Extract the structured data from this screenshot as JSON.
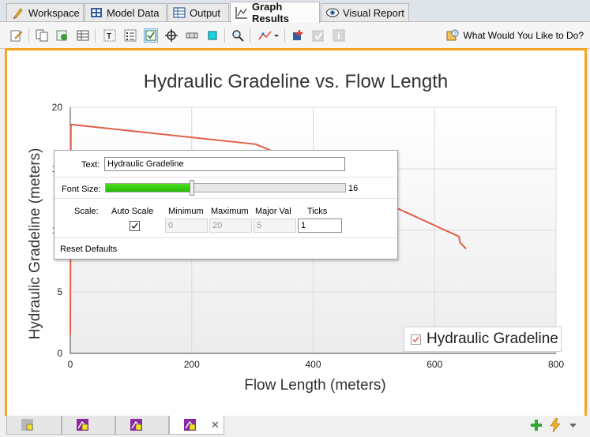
{
  "tabs": [
    {
      "label": "Workspace",
      "icon": "workspace-icon",
      "active": false
    },
    {
      "label": "Model Data",
      "icon": "model-data-icon",
      "active": false
    },
    {
      "label": "Output",
      "icon": "output-icon",
      "active": false
    },
    {
      "label": "Graph Results",
      "icon": "graph-results-icon",
      "active": true
    },
    {
      "label": "Visual Report",
      "icon": "visual-report-icon",
      "active": false
    }
  ],
  "toolbar": {
    "icons": [
      "edit-icon",
      "copy-icon",
      "export-icon",
      "table-icon",
      "format-text-icon",
      "list-icon",
      "checkbox-icon",
      "crosshair-icon",
      "segment-icon",
      "square-icon",
      "zoom-icon",
      "line-style-icon",
      "add-icon",
      "check-disabled-icon",
      "info-disabled-icon"
    ],
    "what_would_you_like": "What Would You Like to Do?"
  },
  "graph": {
    "title": "Hydraulic Gradeline vs. Flow Length",
    "xlabel": "Flow Length (meters)",
    "ylabel": "Hydraulic Gradeline (meters)",
    "legend_label": "Hydraulic Gradeline",
    "legend_checked": true
  },
  "chart_data": {
    "type": "line",
    "title": "Hydraulic Gradeline vs. Flow Length",
    "xlabel": "Flow Length (meters)",
    "ylabel": "Hydraulic Gradeline (meters)",
    "xlim": [
      0,
      800
    ],
    "ylim": [
      0,
      20
    ],
    "xticks": [
      0,
      200,
      400,
      600,
      800
    ],
    "yticks": [
      0,
      5,
      10,
      15,
      20
    ],
    "grid": true,
    "legend_position": "bottom-right",
    "series": [
      {
        "name": "Hydraulic Gradeline",
        "color": "#e0604a",
        "x": [
          0,
          1,
          2,
          305,
          310,
          325,
          640,
          642,
          652
        ],
        "y": [
          1.5,
          18.5,
          18.6,
          17.0,
          16.9,
          16.6,
          9.5,
          9.0,
          8.5
        ]
      }
    ]
  },
  "popup": {
    "text_label": "Text:",
    "text_value": "Hydraulic Gradeline",
    "font_size_label": "Font Size:",
    "font_size_value": "16",
    "font_size_level": 0.36,
    "scale_label": "Scale:",
    "auto_scale_label": "Auto Scale",
    "auto_scale_checked": true,
    "minimum_label": "Minimum",
    "maximum_label": "Maximum",
    "major_label": "Major Val",
    "ticks_label": "Ticks",
    "minimum_value": "0",
    "maximum_value": "20",
    "major_value": "5",
    "ticks_value": "1",
    "reset_label": "Reset Defaults"
  },
  "bottom_tabs": [
    {
      "icon": "graph-tab-icon-1",
      "active": false,
      "closable": false
    },
    {
      "icon": "graph-tab-icon-2",
      "active": false,
      "closable": false
    },
    {
      "icon": "graph-tab-icon-3",
      "active": false,
      "closable": false
    },
    {
      "icon": "graph-tab-icon-4",
      "active": true,
      "closable": true,
      "close_glyph": "✕"
    }
  ],
  "bottom_actions": [
    "add-tab-icon",
    "lightning-icon",
    "dropdown-arrow-icon"
  ]
}
